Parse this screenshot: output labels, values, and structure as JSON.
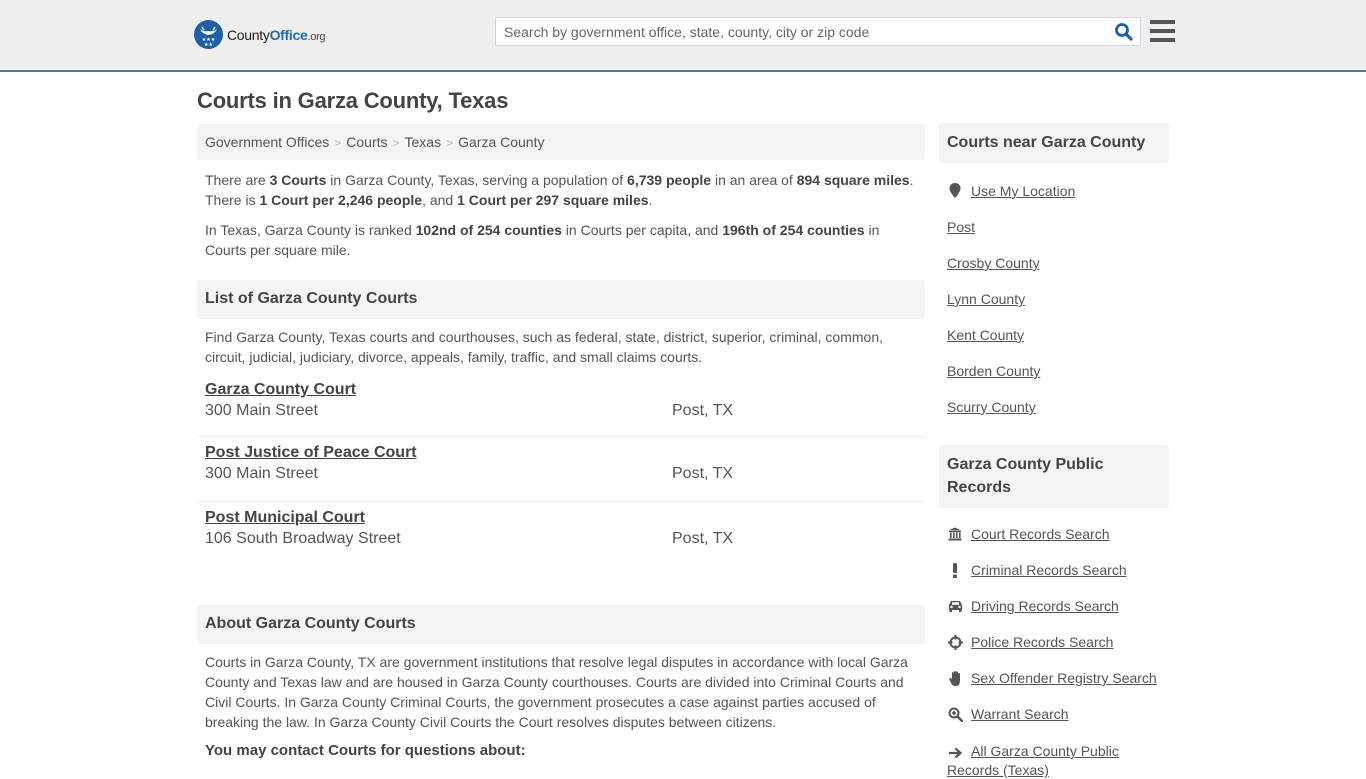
{
  "header": {
    "logo": {
      "county": "County",
      "office": "Office",
      "org": ".org"
    },
    "search_placeholder": "Search by government office, state, county, city or zip code",
    "colors": {
      "brand_blue": "#1e5fa8",
      "header_bg": "#efefef",
      "header_border": "#3a7bb0"
    }
  },
  "page_title": "Courts in Garza County, Texas",
  "breadcrumb": [
    "Government Offices",
    "Courts",
    "Texas",
    "Garza County"
  ],
  "intro": {
    "p1": {
      "t1": "There are ",
      "b1": "3 Courts",
      "t2": " in Garza County, Texas, serving a population of ",
      "b2": "6,739 people",
      "t3": " in an area of ",
      "b3": "894 square miles",
      "t4": ". There is ",
      "b4": "1 Court per 2,246 people",
      "t5": ", and ",
      "b5": "1 Court per 297 square miles",
      "t6": "."
    },
    "p2": {
      "t1": "In Texas, Garza County is ranked ",
      "b1": "102nd of 254 counties",
      "t2": " in Courts per capita, and ",
      "b2": "196th of 254 counties",
      "t3": " in Courts per square mile."
    }
  },
  "list": {
    "heading": "List of Garza County Courts",
    "description": "Find Garza County, Texas courts and courthouses, such as federal, state, district, superior, criminal, common, circuit, judicial, judiciary, divorce, appeals, family, traffic, and small claims courts.",
    "courts": [
      {
        "name": "Garza County Court",
        "address": "300 Main Street",
        "city": "Post, TX"
      },
      {
        "name": "Post Justice of Peace Court",
        "address": "300 Main Street",
        "city": "Post, TX"
      },
      {
        "name": "Post Municipal Court",
        "address": "106 South Broadway Street",
        "city": "Post, TX"
      }
    ]
  },
  "about": {
    "heading": "About Garza County Courts",
    "text": "Courts in Garza County, TX are government institutions that resolve legal disputes in accordance with local Garza County and Texas law and are housed in Garza County courthouses. Courts are divided into Criminal Courts and Civil Courts. In Garza County Criminal Courts, the government prosecutes a case against parties accused of breaking the law. In Garza County Civil Courts the Court resolves disputes between citizens.",
    "contact_heading": "You may contact Courts for questions about:"
  },
  "sidebar": {
    "near": {
      "heading": "Courts near Garza County",
      "use_location": "Use My Location",
      "items": [
        "Post",
        "Crosby County",
        "Lynn County",
        "Kent County",
        "Borden County",
        "Scurry County"
      ]
    },
    "records": {
      "heading": "Garza County Public Records",
      "items": [
        {
          "label": "Court Records Search",
          "icon": "bank-icon"
        },
        {
          "label": "Criminal Records Search",
          "icon": "exclamation-icon"
        },
        {
          "label": "Driving Records Search",
          "icon": "car-icon"
        },
        {
          "label": "Police Records Search",
          "icon": "crosshairs-icon"
        },
        {
          "label": "Sex Offender Registry Search",
          "icon": "hand-icon"
        },
        {
          "label": "Warrant Search",
          "icon": "zoom-in-icon"
        }
      ],
      "all_link": "All Garza County Public Records (Texas)"
    }
  }
}
